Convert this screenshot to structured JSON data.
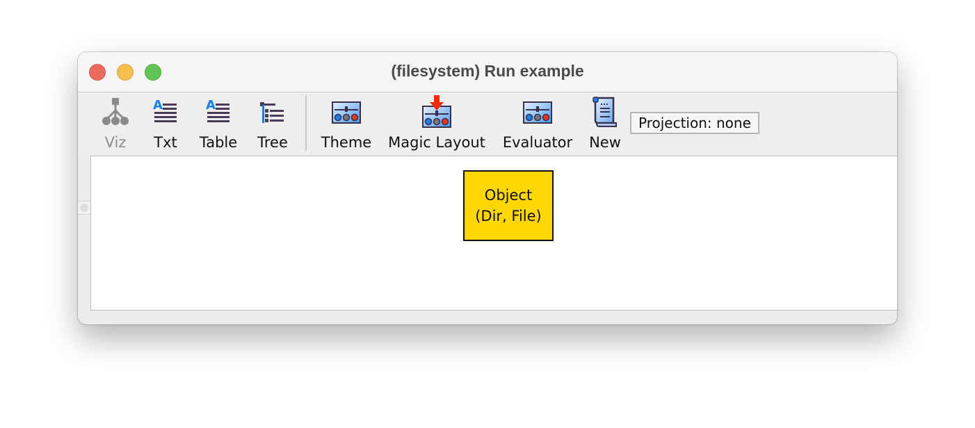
{
  "window": {
    "title": "(filesystem) Run example"
  },
  "toolbar": {
    "buttons": [
      {
        "label": "Viz",
        "icon": "graph-tree-icon",
        "enabled": false
      },
      {
        "label": "Txt",
        "icon": "text-icon",
        "enabled": true
      },
      {
        "label": "Table",
        "icon": "table-icon",
        "enabled": true
      },
      {
        "label": "Tree",
        "icon": "tree-list-icon",
        "enabled": true
      },
      {
        "label": "Theme",
        "icon": "theme-panel-icon",
        "enabled": true
      },
      {
        "label": "Magic Layout",
        "icon": "magic-layout-icon",
        "enabled": true
      },
      {
        "label": "Evaluator",
        "icon": "evaluator-panel-icon",
        "enabled": true
      },
      {
        "label": "New",
        "icon": "scroll-icon",
        "enabled": true
      }
    ],
    "projection_label": "Projection: none"
  },
  "graph": {
    "nodes": [
      {
        "line1": "Object",
        "line2": "(Dir, File)",
        "fill": "#ffd700"
      }
    ]
  },
  "colors": {
    "node_fill": "#ffd700",
    "accent_blue": "#1a7fe8",
    "accent_red": "#e8341a"
  }
}
